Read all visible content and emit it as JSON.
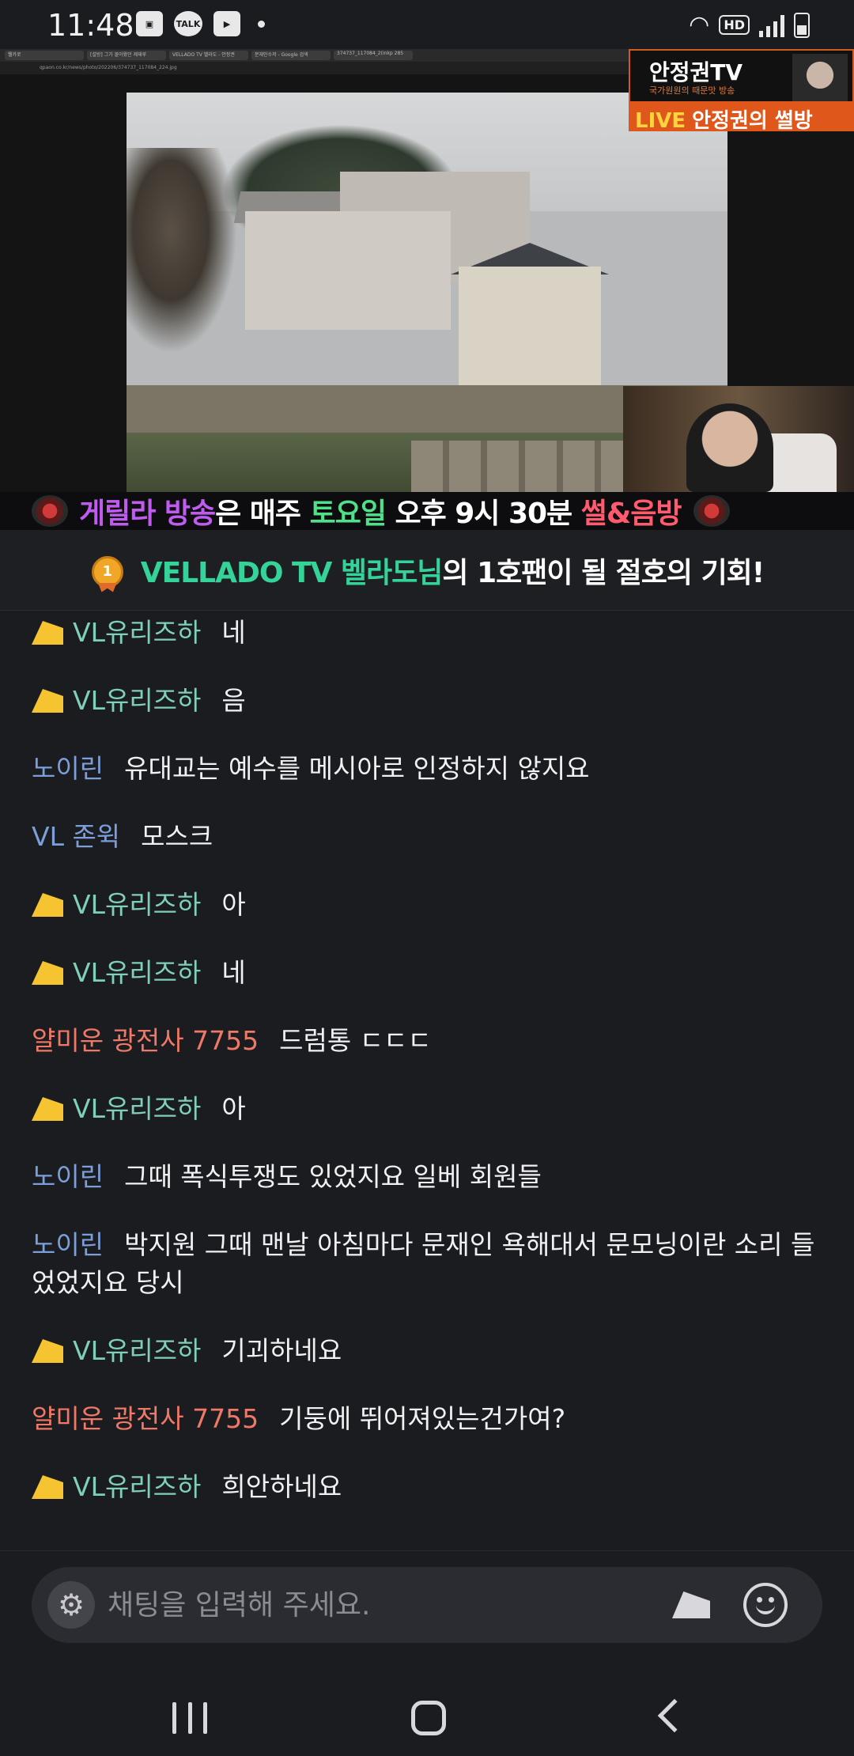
{
  "status_bar": {
    "time": "11:48",
    "left_icons": [
      "image-icon",
      "talk-icon",
      "youtube-icon",
      "dot-icon"
    ],
    "talk_label": "TALK",
    "right_icons": [
      "wifi-icon",
      "hd-icon",
      "signal-icon",
      "battery-charging-icon"
    ],
    "hd_label": "HD"
  },
  "video": {
    "browser_tabs": [
      "웰카로",
      "[설방] 그가 몰아왔던 제재루",
      "VELLADO TV 벨라도 - 안정권",
      "문재인수저 - Google 검색",
      "374737_117084_2(inkp 285"
    ],
    "browser_url": "qpaon.co.kr/news/photo/202206/374737_117084_224.jpg",
    "channel_logo": {
      "title": "안정권TV",
      "subtitle": "국가원원의 때문맛 방송"
    },
    "live_banner": {
      "live_word": "LIVE",
      "text": "안정권의 썰방"
    },
    "ticker": {
      "part1": "게릴라 방송",
      "part2": "은 매주 ",
      "part3": "토요일",
      "part4": " 오후 9시 30분 ",
      "part5": "썰&음방"
    }
  },
  "notice": {
    "medal_number": "1",
    "highlight": "VELLADO TV 벨라도님",
    "text": "의 1호팬이 될 절호의 기회!"
  },
  "chat": {
    "messages": [
      {
        "cheese": true,
        "nick": "VL유리즈하",
        "nick_color": "mint",
        "text": "네"
      },
      {
        "cheese": true,
        "nick": "VL유리즈하",
        "nick_color": "mint",
        "text": "음"
      },
      {
        "cheese": false,
        "nick": "노이린",
        "nick_color": "blue",
        "text": "유대교는 예수를 메시아로 인정하지 않지요"
      },
      {
        "cheese": false,
        "nick": "VL 존윅",
        "nick_color": "blue",
        "text": "모스크"
      },
      {
        "cheese": true,
        "nick": "VL유리즈하",
        "nick_color": "mint",
        "text": "아"
      },
      {
        "cheese": true,
        "nick": "VL유리즈하",
        "nick_color": "mint",
        "text": "네"
      },
      {
        "cheese": false,
        "nick": "얄미운 광전사 7755",
        "nick_color": "coral",
        "text": "드럼통 ㄷㄷㄷ"
      },
      {
        "cheese": true,
        "nick": "VL유리즈하",
        "nick_color": "mint",
        "text": "아"
      },
      {
        "cheese": false,
        "nick": "노이린",
        "nick_color": "blue",
        "text": "그때 폭식투쟁도 있었지요 일베 회원들"
      },
      {
        "cheese": false,
        "nick": "노이린",
        "nick_color": "blue",
        "text": "박지원 그때 맨날 아침마다 문재인 욕해대서 문모닝이란 소리 들었었지요 당시"
      },
      {
        "cheese": true,
        "nick": "VL유리즈하",
        "nick_color": "mint",
        "text": "기괴하네요"
      },
      {
        "cheese": false,
        "nick": "얄미운 광전사 7755",
        "nick_color": "coral",
        "text": "기둥에 뛰어져있는건가여?"
      },
      {
        "cheese": true,
        "nick": "VL유리즈하",
        "nick_color": "mint",
        "text": "희안하네요"
      }
    ]
  },
  "input": {
    "placeholder": "채팅을 입력해 주세요.",
    "value": ""
  },
  "colors": {
    "background": "#1b1c20",
    "nick_mint": "#7ed0bb",
    "nick_blue": "#7c9ed9",
    "nick_coral": "#f07866",
    "notice_highlight": "#34d399",
    "cheese": "#f5c430"
  }
}
